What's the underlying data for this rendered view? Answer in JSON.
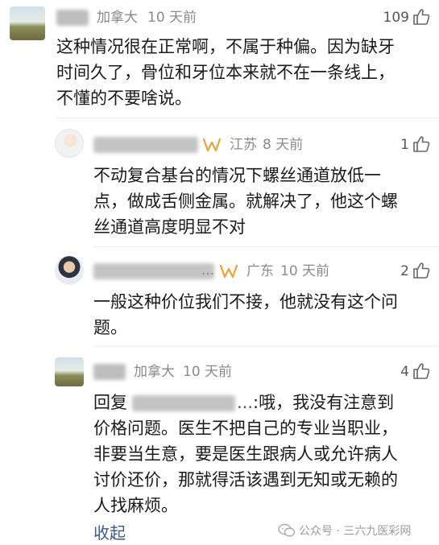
{
  "comments": [
    {
      "region": "加拿大",
      "time": "10 天前",
      "likes": "109",
      "lines": [
        "这种情况很在正常啊，不属于种偏。因为缺牙",
        "时间久了，骨位和牙位本来就不在一条线上，",
        "不懂的不要啥说。"
      ]
    },
    {
      "region": "江苏",
      "time": "8 天前",
      "likes": "1",
      "lines": [
        "不动复合基台的情况下螺丝通道放低一",
        "点，做成舌侧金属。就解决了，他这个螺",
        "丝通道高度明显不对"
      ]
    },
    {
      "region": "广东",
      "time": "10 天前",
      "likes": "2",
      "lines": [
        "一般这种价位我们不接，他就没有这个问",
        "题。"
      ]
    },
    {
      "region": "加拿大",
      "time": "10 天前",
      "likes": "4",
      "reply_prefix": "回复",
      "reply_ellipsis": "...",
      "first_line_rest": ":哦，我没有注意到",
      "lines": [
        "价格问题。医生不把自己的专业当职业，",
        "非要当生意，要是医生跟病人或允许病人",
        "讨价还价，那就得活该遇到无知或无赖的",
        "人找麻烦。"
      ]
    }
  ],
  "collapse_label": "收起",
  "watermark": "公众号 · 三六九医彩网",
  "icons": {
    "like": "thumbs-up-icon",
    "badge": "vip-badge-icon",
    "watermark": "wechat-icon"
  },
  "colors": {
    "meta": "#8a8a8a",
    "link": "#3b5a8c",
    "badge": "#e8a33a"
  }
}
